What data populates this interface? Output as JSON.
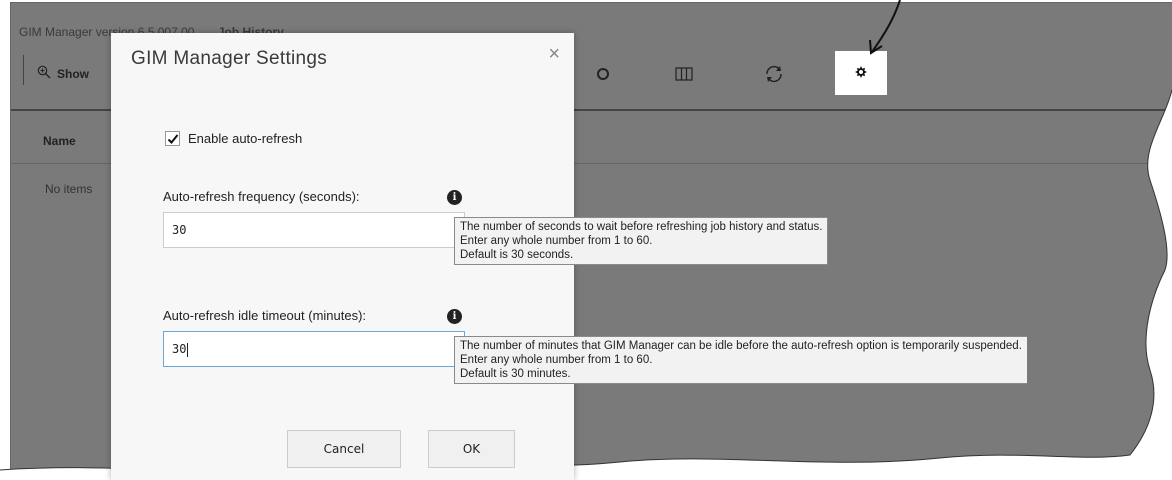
{
  "app": {
    "title": "GIM Manager version 6.5.007.00",
    "job_title": "Job History",
    "show_button_label": "Show",
    "column_name": "Name",
    "no_items_text": "No items"
  },
  "toolbar": {
    "icons": [
      "stop-icon",
      "columns-icon",
      "refresh-icon",
      "gear-icon"
    ]
  },
  "dialog": {
    "title": "GIM Manager Settings",
    "close_glyph": "×",
    "checkbox_label": "Enable auto-refresh",
    "checkbox_checked": true,
    "frequency_label": "Auto-refresh frequency (seconds):",
    "frequency_value": "30",
    "timeout_label": "Auto-refresh idle timeout (minutes):",
    "timeout_value": "30",
    "cancel_label": "Cancel",
    "ok_label": "OK"
  },
  "tooltips": {
    "frequency": {
      "line1": "The number of seconds to wait before refreshing job history and status.",
      "line2": "Enter any whole number from 1 to 60.",
      "line3": "Default is 30 seconds."
    },
    "timeout": {
      "line1": "The number of minutes that GIM Manager can be idle before the auto-refresh option is temporarily suspended.",
      "line2": "Enter any whole number from 1 to 60.",
      "line3": "Default is 30 minutes."
    }
  },
  "colors": {
    "backdrop": "#7a7a7a",
    "dialog_bg": "#f7f7f7",
    "focus_border": "#6aa6d8"
  }
}
